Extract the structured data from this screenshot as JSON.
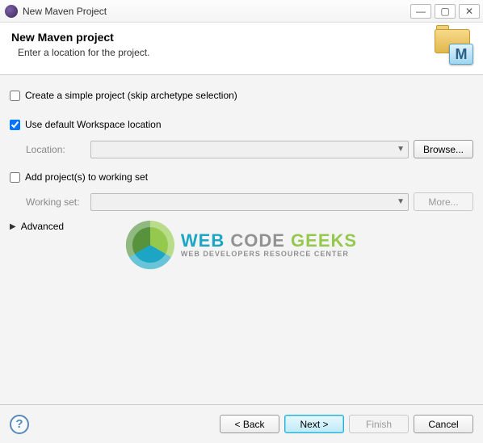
{
  "window": {
    "title": "New Maven Project"
  },
  "header": {
    "title": "New Maven project",
    "subtitle": "Enter a location for the project.",
    "badge_letter": "M"
  },
  "options": {
    "simple_project": {
      "label": "Create a simple project (skip archetype selection)",
      "checked": false
    },
    "default_workspace": {
      "label": "Use default Workspace location",
      "checked": true
    },
    "add_working_set": {
      "label": "Add project(s) to working set",
      "checked": false
    }
  },
  "location": {
    "label": "Location:",
    "value": "",
    "browse": "Browse..."
  },
  "working_set": {
    "label": "Working set:",
    "value": "",
    "more": "More..."
  },
  "advanced": {
    "label": "Advanced",
    "expanded": false
  },
  "watermark": {
    "line1_words": [
      "WEB",
      "CODE",
      "GEEKS"
    ],
    "line2": "WEB DEVELOPERS RESOURCE CENTER"
  },
  "footer": {
    "back": "< Back",
    "next": "Next >",
    "finish": "Finish",
    "cancel": "Cancel"
  }
}
